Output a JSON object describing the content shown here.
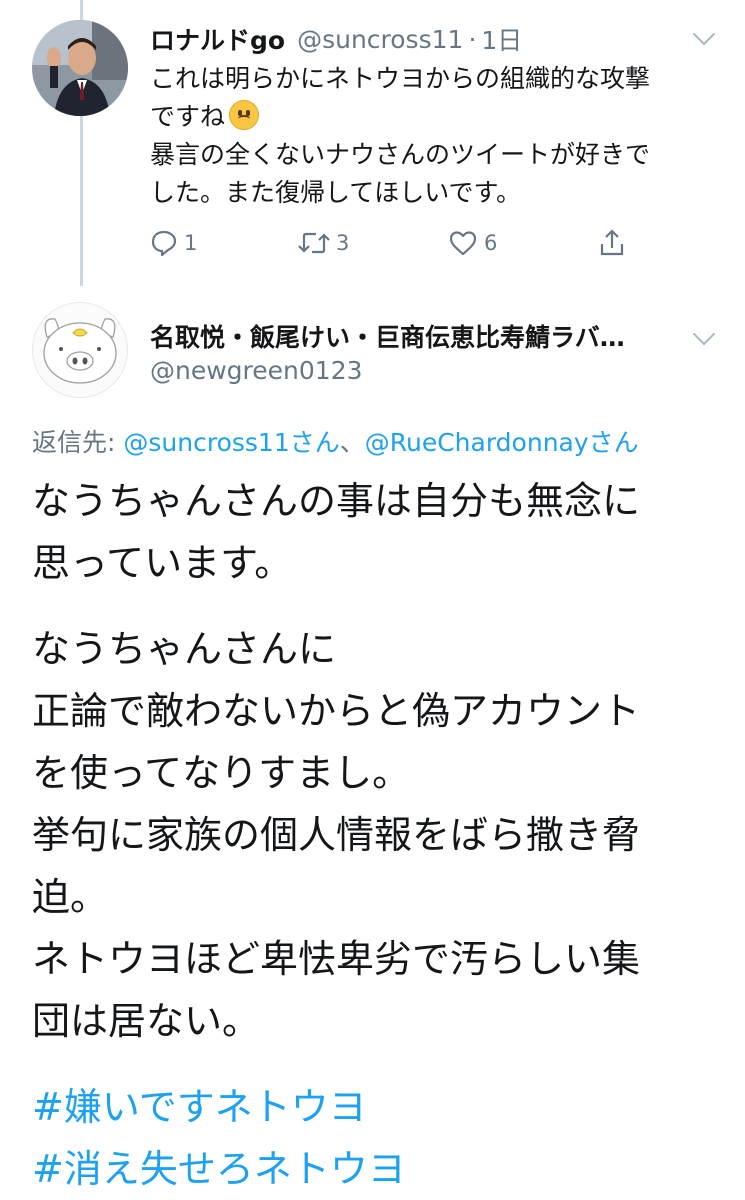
{
  "tweet1": {
    "display_name": "ロナルドgo",
    "handle": "@suncross11",
    "separator": "·",
    "time": "1日",
    "text_line1": "これは明らかにネトウヨからの組織的な攻撃",
    "text_line2": "ですね",
    "emoji": "slightly-frowning-face",
    "text_line3": "暴言の全くないナウさんのツイートが好きで",
    "text_line4": "した。また復帰してほしいです。",
    "reply_count": "1",
    "retweet_count": "3",
    "like_count": "6"
  },
  "tweet2": {
    "display_name": "名取悦・飯尾けい・巨商伝恵比寿鯖ラバ…",
    "handle": "@newgreen0123",
    "reply_prefix": "返信先: ",
    "reply_to_1": "@suncross11さん",
    "reply_sep": "、",
    "reply_to_2": "@RueChardonnayさん",
    "body_lines_p1": [
      "なうちゃんさんの事は自分も無念に",
      "思っています。"
    ],
    "body_lines_p2": [
      "なうちゃんさんに",
      "正論で敵わないからと偽アカウント",
      "を使ってなりすまし。",
      "挙句に家族の個人情報をばら撒き脅",
      "迫。",
      "ネトウヨほど卑怯卑劣で汚らしい集",
      "団は居ない。"
    ],
    "hashtags": [
      "#嫌いですネトウヨ",
      "#消え失せろネトウヨ"
    ]
  },
  "colors": {
    "link": "#1da1f2",
    "muted": "#657786",
    "text": "#14171a",
    "thread_line": "#ccd6dd"
  },
  "icons": [
    "reply-icon",
    "retweet-icon",
    "like-icon",
    "share-icon",
    "chevron-down-icon"
  ]
}
